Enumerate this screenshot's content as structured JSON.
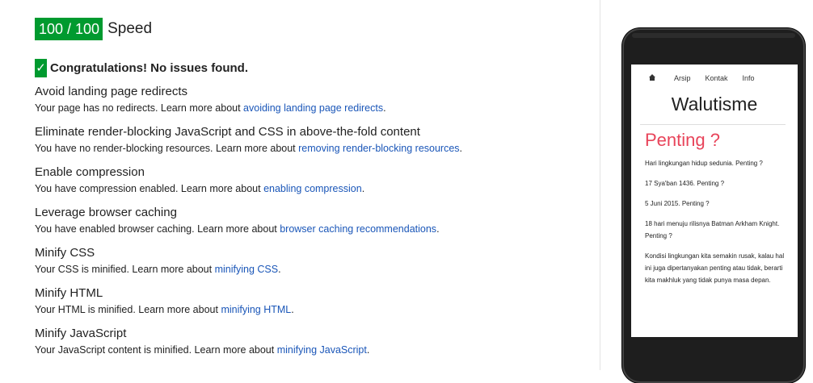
{
  "score": {
    "value": "100 / 100",
    "label": "Speed"
  },
  "congrats": {
    "icon": "checkmark-icon",
    "text": "Congratulations! No issues found."
  },
  "rules": [
    {
      "title": "Avoid landing page redirects",
      "desc": "Your page has no redirects. Learn more about ",
      "link": "avoiding landing page redirects",
      "end": "."
    },
    {
      "title": "Eliminate render-blocking JavaScript and CSS in above-the-fold content",
      "desc": "You have no render-blocking resources. Learn more about ",
      "link": "removing render-blocking resources",
      "end": "."
    },
    {
      "title": "Enable compression",
      "desc": "You have compression enabled. Learn more about ",
      "link": "enabling compression",
      "end": "."
    },
    {
      "title": "Leverage browser caching",
      "desc": "You have enabled browser caching. Learn more about ",
      "link": "browser caching recommendations",
      "end": "."
    },
    {
      "title": "Minify CSS",
      "desc": "Your CSS is minified. Learn more about ",
      "link": "minifying CSS",
      "end": "."
    },
    {
      "title": "Minify HTML",
      "desc": "Your HTML is minified. Learn more about ",
      "link": "minifying HTML",
      "end": "."
    },
    {
      "title": "Minify JavaScript",
      "desc": "Your JavaScript content is minified. Learn more about ",
      "link": "minifying JavaScript",
      "end": "."
    }
  ],
  "preview": {
    "nav": {
      "home_icon": "home-icon",
      "items": [
        "Arsip",
        "Kontak",
        "Info"
      ]
    },
    "blog_title": "Walutisme",
    "post_title": "Penting ?",
    "posts": [
      "Hari lingkungan hidup sedunia. Penting ?",
      "17 Sya'ban 1436. Penting ?",
      "5 Juni 2015. Penting ?",
      "18 hari menuju rilisnya Batman Arkham Knight. Penting ?",
      "Kondisi lingkungan kita semakin rusak, kalau hal ini juga dipertanyakan penting atau tidak, berarti kita makhluk yang tidak punya masa depan."
    ]
  },
  "colors": {
    "score_badge": "#009a2f",
    "link": "#1a56b8",
    "post_title": "#e8445a"
  }
}
